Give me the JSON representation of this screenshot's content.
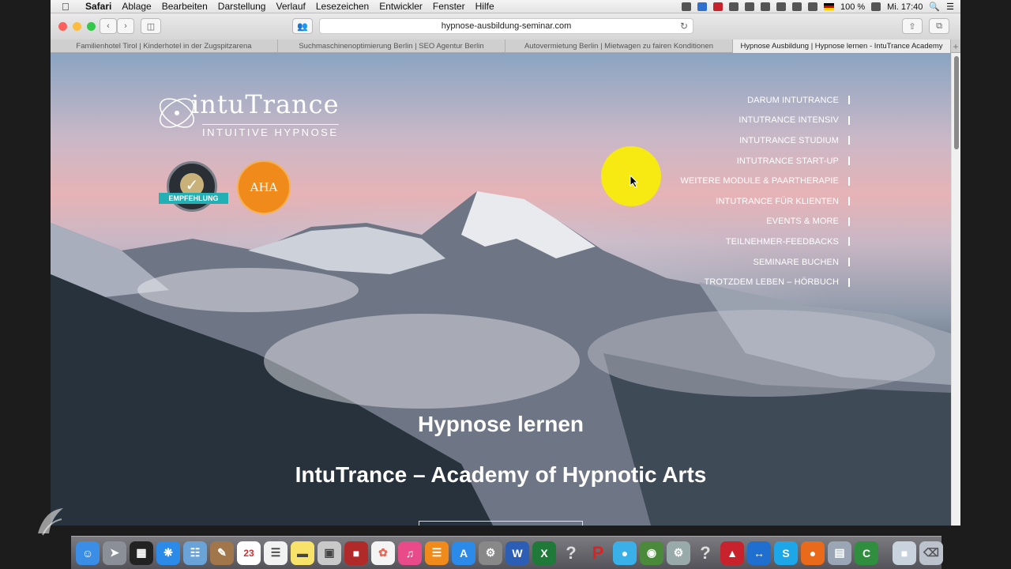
{
  "menubar": {
    "app": "Safari",
    "items": [
      "Ablage",
      "Bearbeiten",
      "Darstellung",
      "Verlauf",
      "Lesezeichen",
      "Entwickler",
      "Fenster",
      "Hilfe"
    ],
    "battery": "100 %",
    "clock": "Mi. 17:40"
  },
  "toolbar": {
    "url": "hypnose-ausbildung-seminar.com"
  },
  "tabs": [
    {
      "title": "Familienhotel Tirol | Kinderhotel in der Zugspitzarena"
    },
    {
      "title": "Suchmaschinenoptimierung Berlin | SEO Agentur Berlin"
    },
    {
      "title": "Autovermietung Berlin | Mietwagen zu fairen Konditionen"
    },
    {
      "title": "Hypnose Ausbildung | Hypnose lernen - IntuTrance Academy"
    }
  ],
  "logo": {
    "wordmark": "intuTrance",
    "tagline": "INTUITIVE HYPNOSE"
  },
  "badges": {
    "proven_expert": "EMPFEHLUNG",
    "aha": "AHA"
  },
  "nav": [
    "DARUM INTUTRANCE",
    "INTUTRANCE INTENSIV",
    "INTUTRANCE STUDIUM",
    "INTUTRANCE START-UP",
    "WEITERE MODULE & PAARTHERAPIE",
    "INTUTRANCE FÜR KLIENTEN",
    "EVENTS & MORE",
    "TEILNEHMER-FEEDBACKS",
    "SEMINARE BUCHEN",
    "TROTZDEM LEBEN – HÖRBUCH"
  ],
  "hero": {
    "title": "Hypnose lernen",
    "subtitle": "IntuTrance – Academy of Hypnotic Arts"
  },
  "dock": [
    "finder-icon",
    "launchpad-icon",
    "mission-control-icon",
    "safari-icon",
    "preview-icon",
    "notes-icon",
    "calendar-icon",
    "reminders-icon",
    "stickies-icon",
    "photo-booth-icon",
    "photo-icon",
    "photos-icon",
    "itunes-icon",
    "ibooks-icon",
    "app-store-icon",
    "system-preferences-icon",
    "word-icon",
    "excel-icon",
    "help-icon",
    "powerpoint-icon",
    "messages-icon",
    "network-icon",
    "utility-icon",
    "help-icon",
    "acrobat-icon",
    "teamviewer-icon",
    "skype-icon",
    "firefox-icon",
    "scanner-icon",
    "camtasia-icon",
    "folder-icon",
    "trash-icon"
  ],
  "dock_calendar_day": "23",
  "colors": {
    "highlight": "#f6ea12",
    "aha_badge": "#f08a1a"
  }
}
